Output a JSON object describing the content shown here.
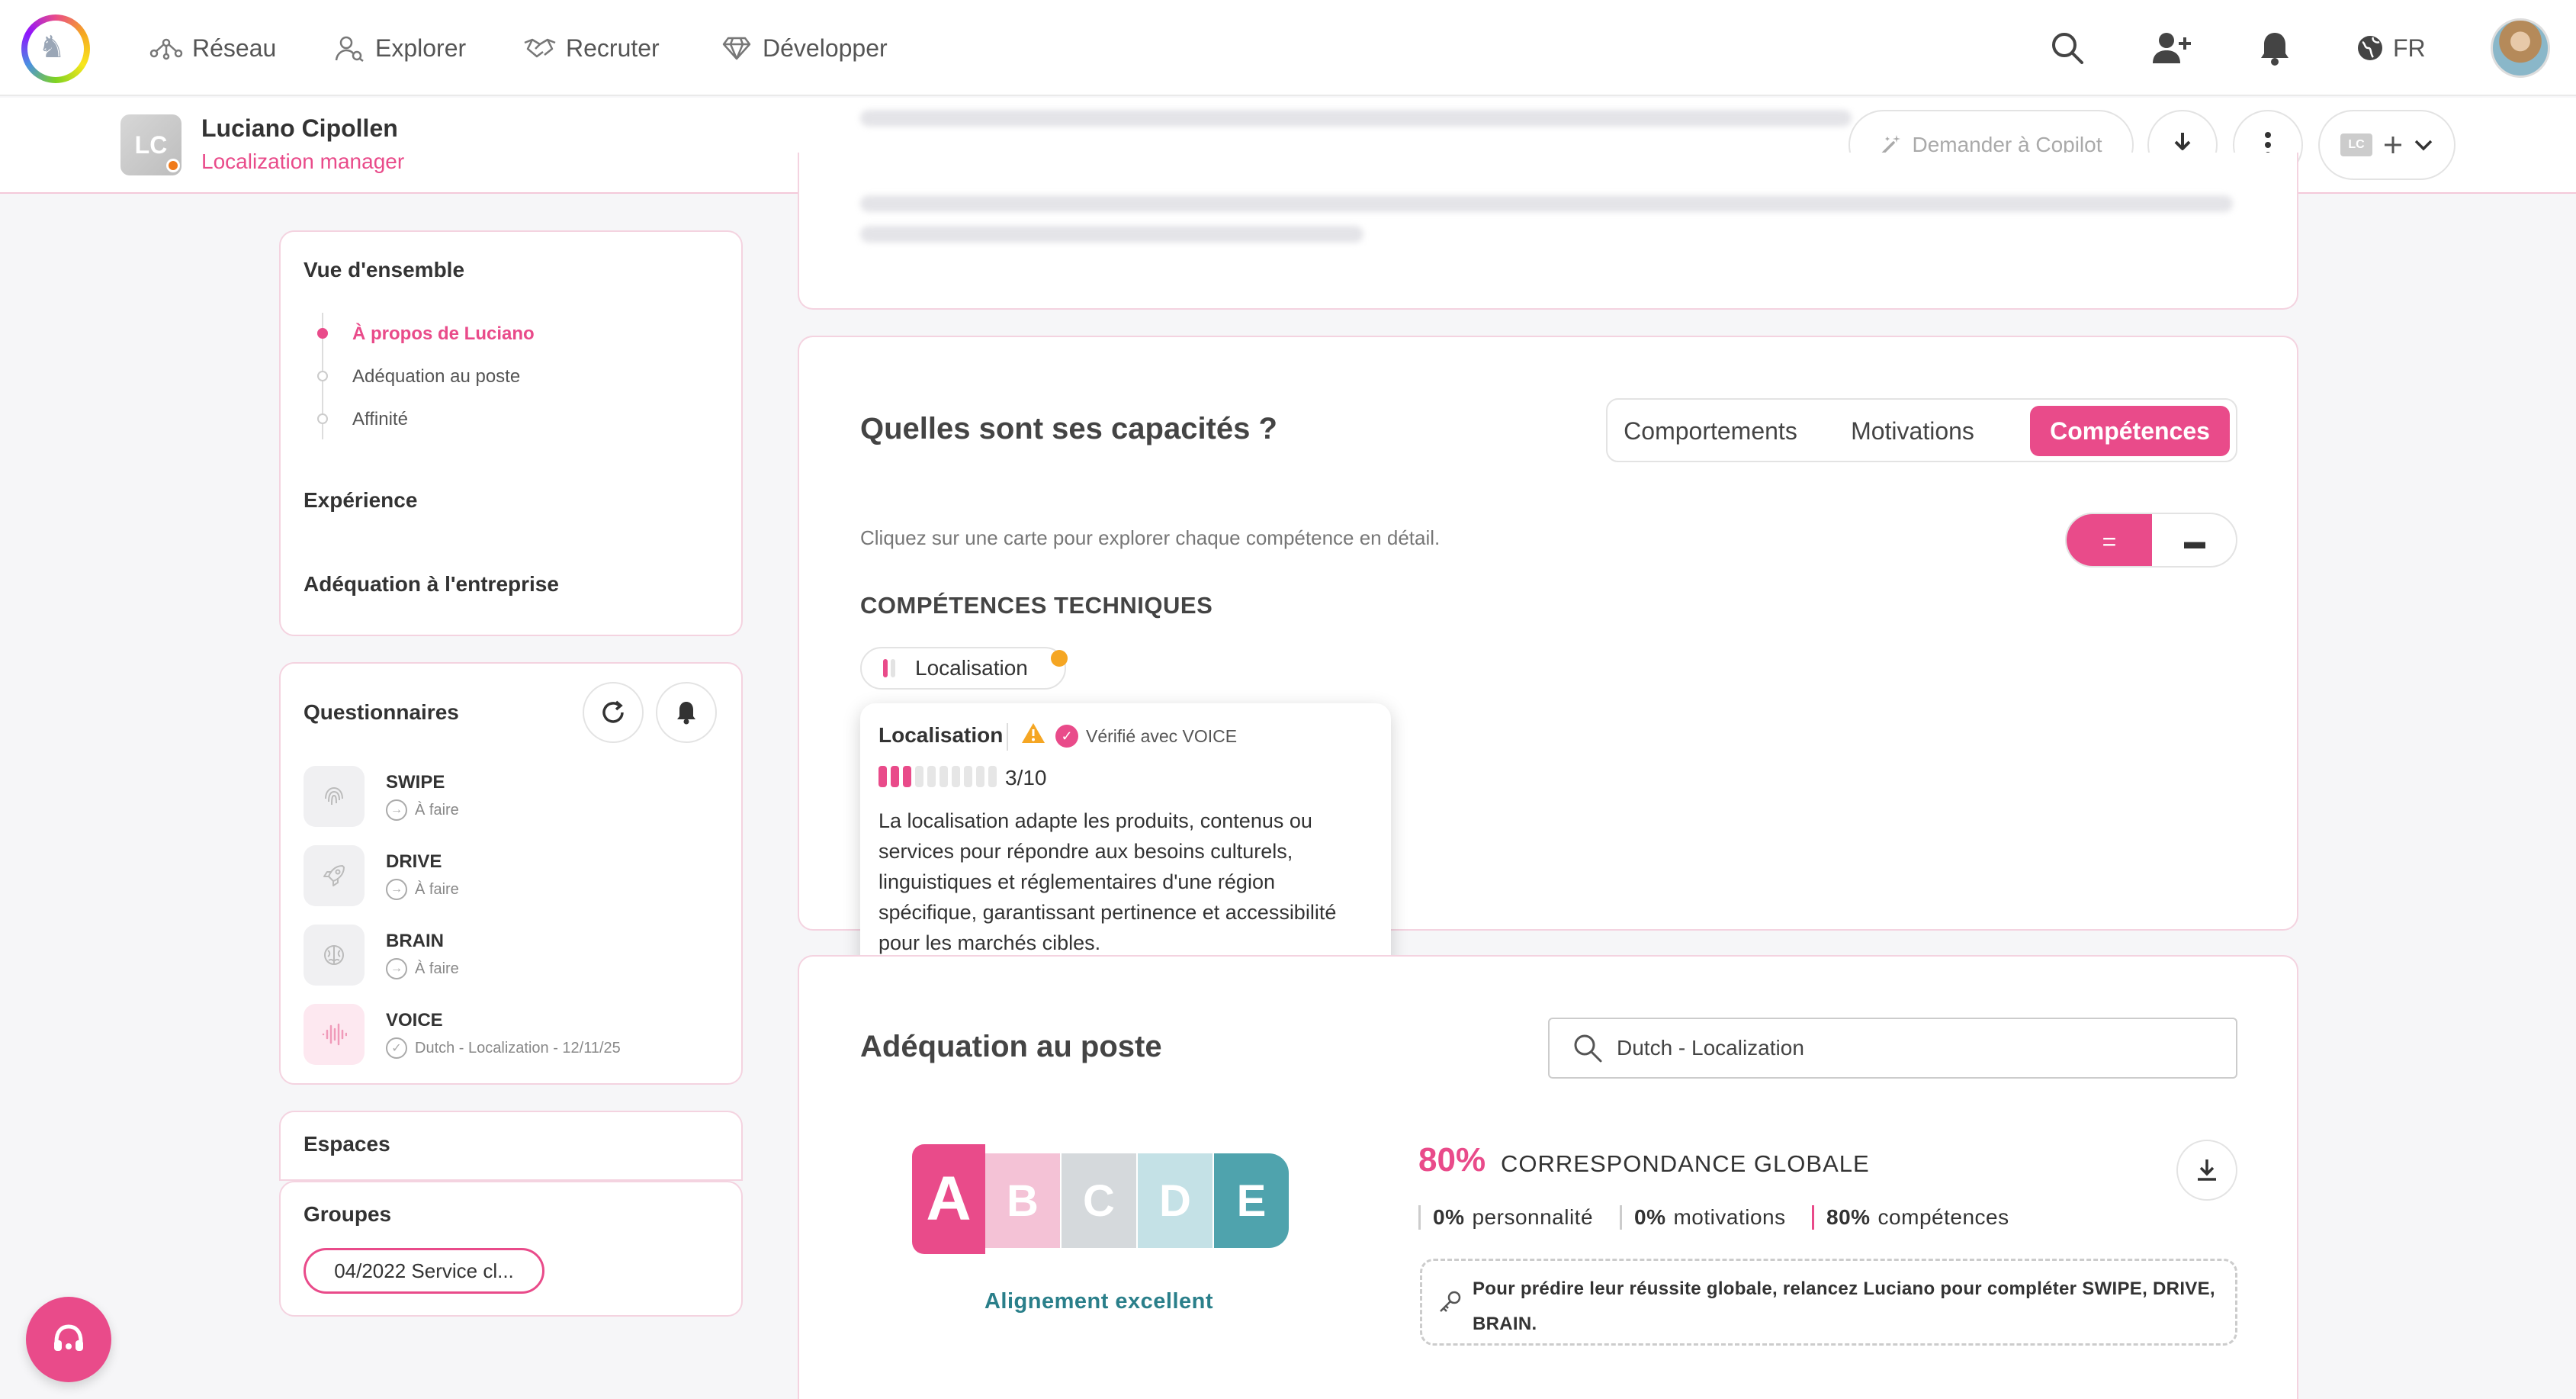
{
  "nav": {
    "items": [
      {
        "label": "Réseau",
        "icon": "network-icon"
      },
      {
        "label": "Explorer",
        "icon": "people-search-icon"
      },
      {
        "label": "Recruter",
        "icon": "handshake-icon"
      },
      {
        "label": "Développer",
        "icon": "diamond-icon"
      }
    ],
    "lang": "FR"
  },
  "profile": {
    "initials": "LC",
    "name": "Luciano Cipollen",
    "role": "Localization manager",
    "copilot_label": "Demander à Copilot",
    "mini_initials": "LC"
  },
  "sidebar": {
    "overview_title": "Vue d'ensemble",
    "toc": [
      {
        "label": "À propos de Luciano",
        "active": true
      },
      {
        "label": "Adéquation au poste",
        "active": false
      },
      {
        "label": "Affinité",
        "active": false
      }
    ],
    "experience": "Expérience",
    "company_fit": "Adéquation à l'entreprise",
    "questionnaires_title": "Questionnaires",
    "questionnaires": [
      {
        "name": "SWIPE",
        "status": "À faire",
        "icon": "fingerprint-icon"
      },
      {
        "name": "DRIVE",
        "status": "À faire",
        "icon": "rocket-icon"
      },
      {
        "name": "BRAIN",
        "status": "À faire",
        "icon": "brain-icon"
      },
      {
        "name": "VOICE",
        "status": "Dutch - Localization - 12/11/25",
        "icon": "voice-wave-icon"
      }
    ],
    "spaces_title": "Espaces",
    "groups_title": "Groupes",
    "group_pill": "04/2022 Service cl..."
  },
  "capacities": {
    "title": "Quelles sont ses capacités ?",
    "tabs": [
      {
        "label": "Comportements",
        "active": false
      },
      {
        "label": "Motivations",
        "active": false
      },
      {
        "label": "Compétences",
        "active": true
      }
    ],
    "hint": "Cliquez sur une carte pour explorer chaque compétence en détail.",
    "toggle_left": "=",
    "toggle_right": "▬",
    "subsection": "COMPÉTENCES TECHNIQUES",
    "skill_chip": "Localisation",
    "chip_level": 1,
    "popup": {
      "title": "Localisation",
      "verified": "Vérifié avec VOICE",
      "level": 3,
      "max": 10,
      "score": "3/10",
      "description": "La localisation adapte les produits, contenus ou services pour répondre aux besoins culturels, linguistiques et réglementaires d'une région spécifique, garantissant pertinence et accessibilité pour les marchés cibles."
    }
  },
  "job_fit": {
    "title": "Adéquation au poste",
    "search_value": "Dutch - Localization",
    "grades": [
      {
        "letter": "A",
        "color": "#e94b8a",
        "active": true
      },
      {
        "letter": "B",
        "color": "#f4c2d6",
        "active": false
      },
      {
        "letter": "C",
        "color": "#d5d9dc",
        "active": false
      },
      {
        "letter": "D",
        "color": "#c4e1e6",
        "active": false
      },
      {
        "letter": "E",
        "color": "#4fa3ad",
        "active": false
      }
    ],
    "alignment": "Alignement excellent",
    "match_pct": "80%",
    "match_label": "CORRESPONDANCE GLOBALE",
    "metrics": [
      {
        "value": "0%",
        "label": "personnalité"
      },
      {
        "value": "0%",
        "label": "motivations"
      },
      {
        "value": "80%",
        "label": "compétences"
      }
    ],
    "note": "Pour prédire leur réussite globale, relancez Luciano pour compléter SWIPE, DRIVE, BRAIN."
  },
  "colors": {
    "accent": "#e94b8a",
    "teal": "#2a7f8a",
    "warning": "#f5a623"
  }
}
